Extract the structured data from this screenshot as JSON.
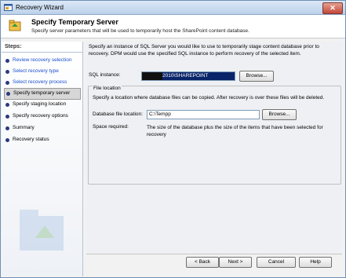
{
  "window": {
    "title": "Recovery Wizard",
    "close_glyph": "✕"
  },
  "header": {
    "title": "Specify Temporary Server",
    "subtitle": "Specify server parameters that will be used to temporarily host the SharePoint content database."
  },
  "sidebar": {
    "label": "Steps:",
    "items": [
      {
        "label": "Review recovery selection",
        "state": "done"
      },
      {
        "label": "Select recovery type",
        "state": "done"
      },
      {
        "label": "Select recovery process",
        "state": "done"
      },
      {
        "label": "Specify temporary server",
        "state": "current"
      },
      {
        "label": "Specify staging location",
        "state": "pending"
      },
      {
        "label": "Specify recovery options",
        "state": "pending"
      },
      {
        "label": "Summary",
        "state": "pending"
      },
      {
        "label": "Recovery status",
        "state": "pending"
      }
    ]
  },
  "main": {
    "intro": "Specify an instance of SQL Server you would like to use to temporarily stage content database prior to recovery. DPM would use the specified SQL instance to perform recovery of the selected item.",
    "sql_instance_label": "SQL instance:",
    "sql_instance_value": "2010\\SHAREPOINT",
    "browse_label": "Browse...",
    "file_location": {
      "title": "File location",
      "description": "Specify a location where database files can be copied. After recovery is over these files will be deleted.",
      "path_label": "Database file location:",
      "path_value": "C:\\Tempp",
      "browse_label": "Browse...",
      "space_label": "Space required:",
      "space_text": "The size of the database plus the size of the items that have been selected for recovery"
    }
  },
  "footer": {
    "back_label": "< Back",
    "next_label": "Next >",
    "cancel_label": "Cancel",
    "help_label": "Help"
  },
  "colors": {
    "link": "#1a4fd0",
    "accent": "#0a246a",
    "title_bar": "#bcd1ea"
  },
  "icons": [
    "recovery-wizard-icon",
    "server-wizard-icon",
    "close-icon",
    "bullet-icon",
    "watermark-icon"
  ]
}
